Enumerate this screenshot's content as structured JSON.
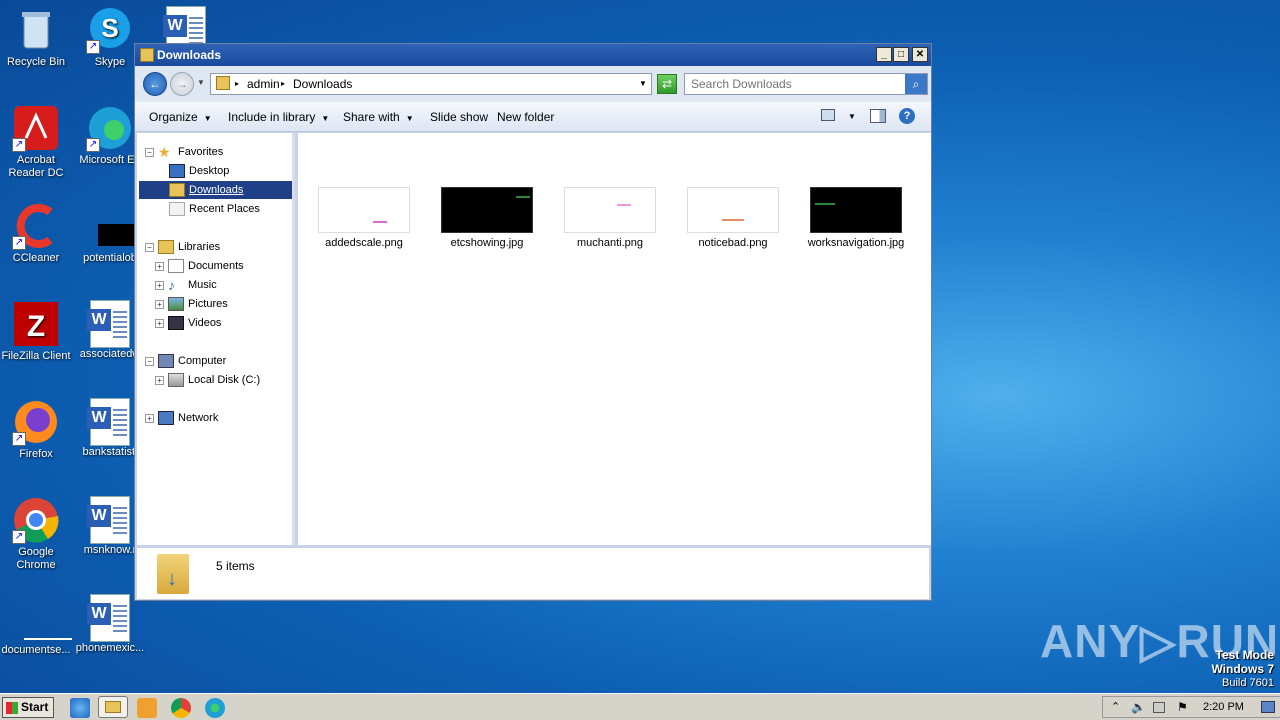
{
  "desktop": {
    "icons": [
      {
        "label": "Recycle Bin"
      },
      {
        "label": "Skype"
      },
      {
        "label": "Acrobat Reader DC"
      },
      {
        "label": "Microsoft Ed"
      },
      {
        "label": "CCleaner"
      },
      {
        "label": "potentialob"
      },
      {
        "label": "FileZilla Client"
      },
      {
        "label": "associatedw"
      },
      {
        "label": "Firefox"
      },
      {
        "label": "bankstatisti"
      },
      {
        "label": "Google Chrome"
      },
      {
        "label": "msnknow.r"
      },
      {
        "label": "documentse..."
      },
      {
        "label": "phonemexic..."
      }
    ]
  },
  "window": {
    "title": "Downloads",
    "controls": {
      "minimize": "_",
      "maximize": "□",
      "close": "✕"
    },
    "breadcrumb": [
      "admin",
      "Downloads"
    ],
    "search_placeholder": "Search Downloads",
    "toolbar": {
      "organize": "Organize",
      "include_in_library": "Include in library",
      "share_with": "Share with",
      "slide_show": "Slide show",
      "new_folder": "New folder"
    },
    "nav": {
      "favorites": "Favorites",
      "desktop": "Desktop",
      "downloads": "Downloads",
      "recent_places": "Recent Places",
      "libraries": "Libraries",
      "documents": "Documents",
      "music": "Music",
      "pictures": "Pictures",
      "videos": "Videos",
      "computer": "Computer",
      "local_disk": "Local Disk (C:)",
      "network": "Network"
    },
    "files": [
      {
        "name": "addedscale.png",
        "dark": false
      },
      {
        "name": "etcshowing.jpg",
        "dark": true
      },
      {
        "name": "muchanti.png",
        "dark": false
      },
      {
        "name": "noticebad.png",
        "dark": false
      },
      {
        "name": "worksnavigation.jpg",
        "dark": true
      }
    ],
    "status": "5 items"
  },
  "taskbar": {
    "start_label": "Start",
    "clock": "2:20 PM"
  },
  "overlay": {
    "watermark": "ANY▷RUN",
    "test_mode": "Test Mode",
    "os": "Windows 7",
    "build": "Build 7601"
  },
  "colors": {
    "accent": "#1f3f86",
    "titlebar": "#2e63b8"
  }
}
